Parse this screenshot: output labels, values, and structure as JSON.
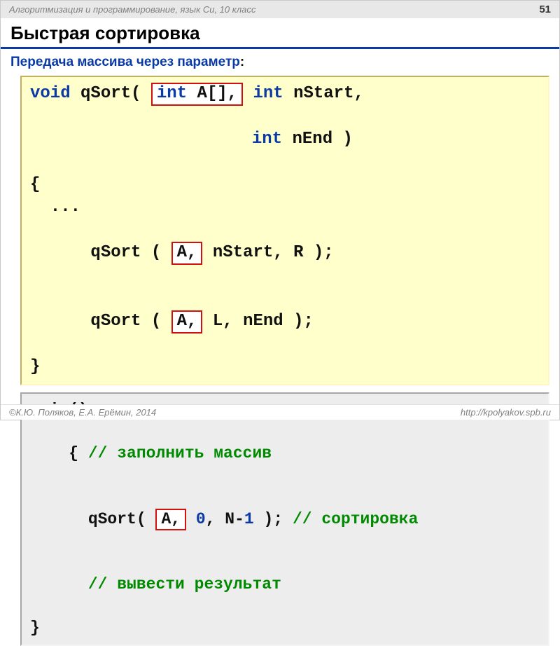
{
  "header": {
    "course": "Алгоритмизация и программирование, язык Си, 10 класс",
    "page_number": "51"
  },
  "title": "Быстрая сортировка",
  "subtitle_label": "Передача массива через параметр",
  "subtitle_colon": ":",
  "box1": {
    "kw_void": "void",
    "fn": " qSort( ",
    "hl_decl": "int A[],",
    "kw_int1": " int",
    "p_nstart": " nStart,",
    "indent_int": "                  ",
    "kw_int2": "int",
    "p_nend": " nEnd )",
    "lbrace": "{",
    "dots": "  ...",
    "r1_pre": "  qSort ( ",
    "r1_hl": "A,",
    "r1_post": " nStart, R );",
    "r2_pre": "  qSort ( ",
    "r2_hl": "A,",
    "r2_post": " L, nEnd );",
    "rbrace": "}"
  },
  "box2": {
    "main_decl": "main()",
    "lbrace": "{ ",
    "c1": "// заполнить массив",
    "call_pre": "  qSort( ",
    "call_hl": "A,",
    "lit_space": " ",
    "lit_zero": "0",
    "call_mid": ", N-",
    "lit_one": "1",
    "call_post": " ); ",
    "c2": "// сортировка",
    "c3_indent": "  ",
    "c3": "// вывести результат",
    "rbrace": "}"
  },
  "footer": {
    "left": "К.Ю. Поляков, Е.А. Ерёмин, 2014",
    "right": "http://kpolyakov.spb.ru"
  }
}
